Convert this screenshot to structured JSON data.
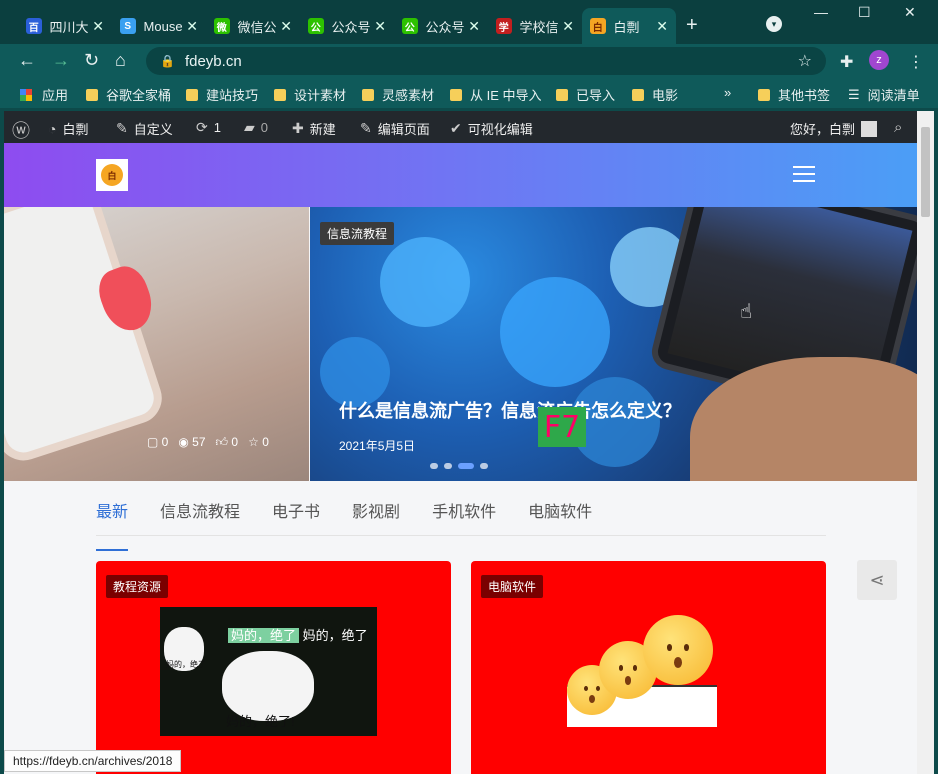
{
  "browser": {
    "tabs": [
      {
        "title": "四川大",
        "fav_color": "#2b5fd9",
        "fav_text": "百"
      },
      {
        "title": "Mouse",
        "fav_color": "#3aa0f0",
        "fav_text": "S"
      },
      {
        "title": "微信公",
        "fav_color": "#2dc100",
        "fav_text": "微"
      },
      {
        "title": "公众号",
        "fav_color": "#2dc100",
        "fav_text": "公"
      },
      {
        "title": "公众号",
        "fav_color": "#2dc100",
        "fav_text": "公"
      },
      {
        "title": "学校信",
        "fav_color": "#c21f1f",
        "fav_text": "学"
      },
      {
        "title": "白剽",
        "fav_color": "#f5a623",
        "fav_text": "白"
      }
    ],
    "close_glyph": "✕",
    "new_tab": "+",
    "url": "fdeyb.cn",
    "profile_initial": "z",
    "bookmarks": [
      {
        "label": "应用",
        "kind": "apps"
      },
      {
        "label": "谷歌全家桶",
        "kind": "folder"
      },
      {
        "label": "建站技巧",
        "kind": "folder"
      },
      {
        "label": "设计素材",
        "kind": "folder"
      },
      {
        "label": "灵感素材",
        "kind": "folder"
      },
      {
        "label": "从 IE 中导入",
        "kind": "folder"
      },
      {
        "label": "已导入",
        "kind": "folder"
      },
      {
        "label": "电影",
        "kind": "folder"
      }
    ],
    "bookmarks_more": "»",
    "other_bookmarks": "其他书签",
    "reading_list": "阅读清单"
  },
  "wpbar": {
    "site": "白剽",
    "customize": "自定义",
    "updates": "1",
    "comments": "0",
    "new": "新建",
    "edit": "编辑页面",
    "visual": "可视化编辑",
    "greeting": "您好，白剽"
  },
  "hero": {
    "left_meta": {
      "comments": "0",
      "views": "57",
      "likes": "0",
      "stars": "0"
    },
    "category": "信息流教程",
    "title": "什么是信息流广告？信息流广告怎么定义？",
    "date": "2021年5月5日",
    "overlay": "F7"
  },
  "nav_tabs": [
    {
      "label": "最新",
      "active": true
    },
    {
      "label": "信息流教程",
      "active": false
    },
    {
      "label": "电子书",
      "active": false
    },
    {
      "label": "影视剧",
      "active": false
    },
    {
      "label": "手机软件",
      "active": false
    },
    {
      "label": "电脑软件",
      "active": false
    }
  ],
  "cards": [
    {
      "tag": "教程资源",
      "meme_top": "妈的，绝了",
      "meme_top2": "妈的，绝了",
      "meme_bottom": "妈的，绝了!",
      "meme_small": "妈的，绝了"
    },
    {
      "tag": "电脑软件"
    }
  ],
  "status_url": "https://fdeyb.cn/archives/2018"
}
